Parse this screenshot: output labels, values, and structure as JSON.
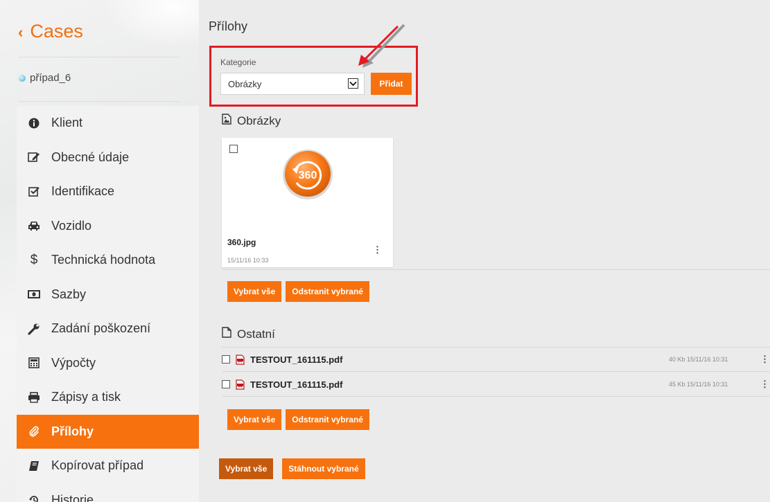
{
  "sidebar": {
    "back_label": "Cases",
    "case_name": "případ_6",
    "items": [
      {
        "label": "Klient",
        "icon": "info-icon"
      },
      {
        "label": "Obecné údaje",
        "icon": "edit-icon"
      },
      {
        "label": "Identifikace",
        "icon": "checkbox-icon"
      },
      {
        "label": "Vozidlo",
        "icon": "car-icon"
      },
      {
        "label": "Technická hodnota",
        "icon": "dollar-icon"
      },
      {
        "label": "Sazby",
        "icon": "money-icon"
      },
      {
        "label": "Zadání poškození",
        "icon": "wrench-icon"
      },
      {
        "label": "Výpočty",
        "icon": "calculator-icon"
      },
      {
        "label": "Zápisy a tisk",
        "icon": "print-icon"
      },
      {
        "label": "Přílohy",
        "icon": "paperclip-icon",
        "active": true
      },
      {
        "label": "Kopírovat případ",
        "icon": "book-icon"
      },
      {
        "label": "Historie",
        "icon": "history-icon"
      }
    ]
  },
  "main": {
    "title": "Přílohy",
    "category": {
      "label": "Kategorie",
      "selected": "Obrázky",
      "add_button": "Přidat"
    },
    "images_section": {
      "title": "Obrázky",
      "files": [
        {
          "name": "360.jpg",
          "date": "15/11/16 10:33",
          "thumb_label": "360"
        }
      ],
      "select_all": "Vybrat vše",
      "remove_selected": "Odstranit vybrané"
    },
    "other_section": {
      "title": "Ostatní",
      "files": [
        {
          "name": "TESTOUT_161115.pdf",
          "meta": "40 Kb 15/11/16 10:31"
        },
        {
          "name": "TESTOUT_161115.pdf",
          "meta": "45 Kb 15/11/16 10:31"
        }
      ],
      "select_all": "Vybrat vše",
      "remove_selected": "Odstranit vybrané"
    },
    "bottom": {
      "select_all": "Vybrat vše",
      "download_selected": "Stáhnout vybrané"
    }
  },
  "colors": {
    "accent": "#f7720f",
    "accent_dark": "#c55a0d",
    "highlight_box": "#e41b23"
  }
}
